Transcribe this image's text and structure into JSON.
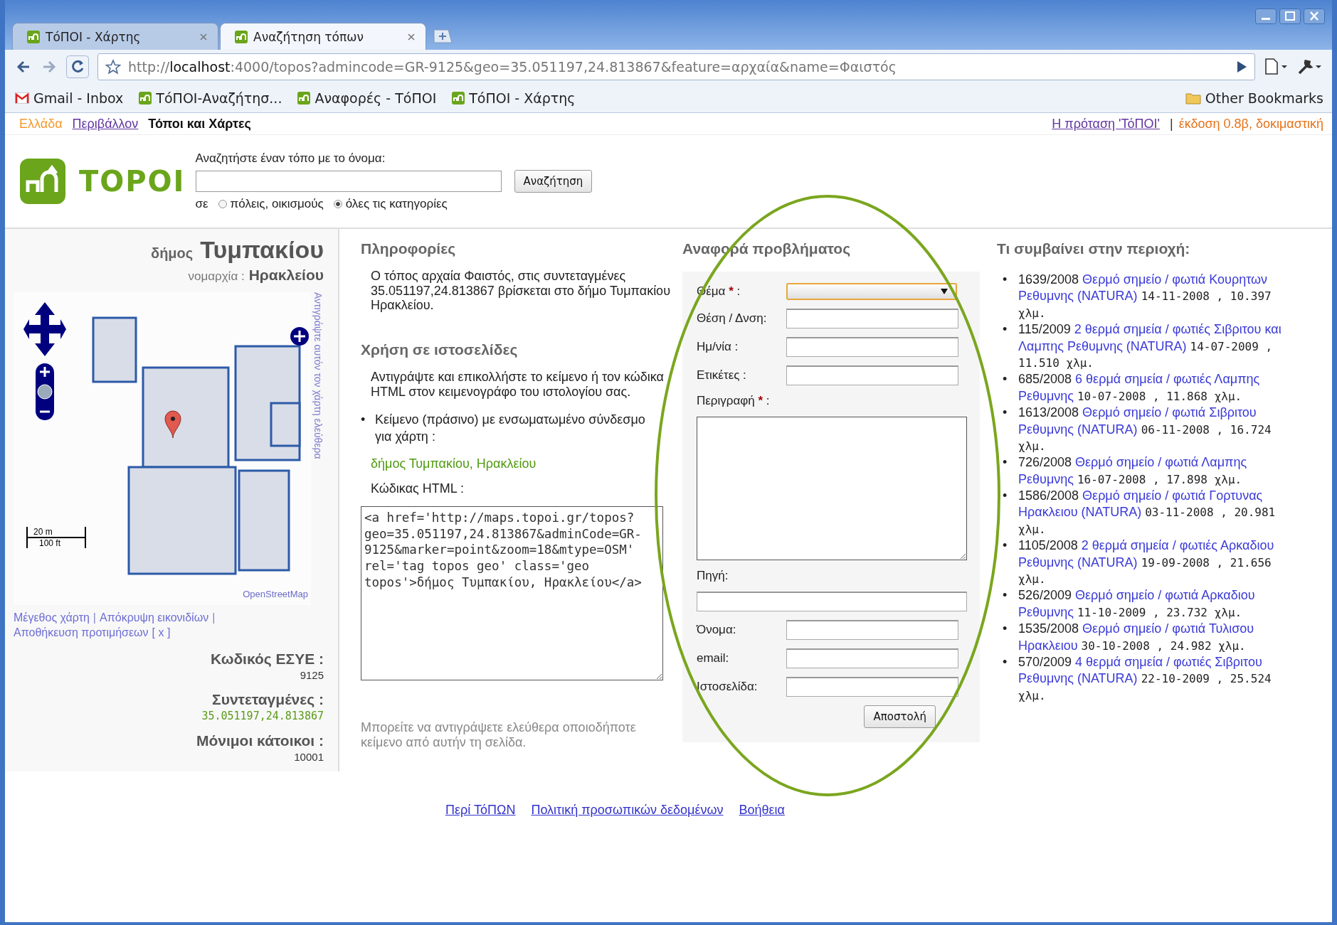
{
  "browser": {
    "tabs": [
      {
        "title": "ΤόΠΟΙ - Χάρτης",
        "selected": false
      },
      {
        "title": "Αναζήτηση τόπων",
        "selected": true
      }
    ],
    "address_bar": {
      "url": "http://**localhost**:4000/topos?admincode=GR-9125&geo=35.051197,24.813867&feature=αρχαία&name=Φαιστός"
    },
    "bookmarks": [
      {
        "kind": "mail",
        "label": "Gmail - Inbox"
      },
      {
        "kind": "site",
        "label": "ΤόΠΟΙ-Αναζήτησ..."
      },
      {
        "kind": "site",
        "label": "Αναφορές - ΤόΠΟΙ"
      },
      {
        "kind": "site",
        "label": "ΤόΠΟΙ - Χάρτης"
      }
    ],
    "other_bookmarks": "Other Bookmarks"
  },
  "top_nav": {
    "left": [
      {
        "kind": "region",
        "label": "Ελλάδα"
      },
      {
        "kind": "link",
        "label": "Περιβάλλον"
      },
      {
        "kind": "current",
        "label": "Τόποι και Χάρτες"
      }
    ],
    "right": [
      {
        "kind": "link",
        "label": "Η πρόταση 'ΤόΠΟΙ'"
      },
      {
        "kind": "separator",
        "label": "|"
      },
      {
        "kind": "version",
        "label": "έκδοση 0.8β, δοκιμαστική"
      }
    ]
  },
  "header": {
    "logo_text": "TOPOI",
    "search_label": "Αναζητήστε έναν τόπο με το όνομα:",
    "search_button": "Αναζήτηση",
    "scope_label": "σε",
    "scope_options": [
      {
        "label": "πόλεις, οικισμούς",
        "selected": false
      },
      {
        "label": "όλες τις κατηγορίες",
        "selected": true
      }
    ]
  },
  "place": {
    "municipality_prefix": "δήμος",
    "municipality": "Τυμπακίου",
    "prefecture_label": "νομαρχία :",
    "prefecture": "Ηρακλείου",
    "map": {
      "copy_hint": "Αντιγράψτε αυτόν τον χάρτη ελεύθερα",
      "scale_metric": "20 m",
      "scale_imperial": "100 ft",
      "attribution": "OpenStreetMap"
    },
    "map_links": [
      {
        "kind": "link",
        "label": "Μέγεθος χάρτη"
      },
      {
        "kind": "separator",
        "label": "|"
      },
      {
        "kind": "link",
        "label": "Απόκρυψη εικονιδίων"
      },
      {
        "kind": "separator",
        "label": "|"
      },
      {
        "kind": "link",
        "label": "Αποθήκευση προτιμήσεων"
      },
      {
        "kind": "link",
        "label": "[ x ]"
      }
    ],
    "facts": [
      {
        "label": "Κωδικός ΕΣΥΕ :",
        "value": "9125",
        "kind": "plain"
      },
      {
        "label": "Συντεταγμένες :",
        "value": "35.051197,24.813867",
        "kind": "coords"
      },
      {
        "label": "Μόνιμοι κάτοικοι :",
        "value": "10001",
        "kind": "plain"
      }
    ]
  },
  "info": {
    "heading": "Πληροφορίες",
    "text": "Ο τόπος αρχαία Φαιστός, στις συντεταγμένες 35.051197,24.813867 βρίσκεται στο δήμο Τυμπακίου Ηρακλείου."
  },
  "usage": {
    "heading": "Χρήση σε ιστοσελίδες",
    "intro": "Αντιγράψτε και επικολλήστε το κείμενο ή τον κώδικα HTML στον κειμενογράφο του ιστολογίου σας.",
    "bullet_mark": "•",
    "bullet": "Κείμενο (πράσινο) με ενσωματωμένο σύνδεσμο για χάρτη :",
    "green_link": "δήμος Τυμπακίου, Ηρακλείου",
    "code_label": "Κώδικας HTML :",
    "code": "<a href='http://maps.topoi.gr/topos?geo=35.051197,24.813867&adminCode=GR-9125&marker=point&zoom=18&mtype=OSM' rel='tag topos geo' class='geo topos'>δήμος Τυμπακίου, Ηρακλείου</a>",
    "note": "Μπορείτε να αντιγράψετε ελεύθερα οποιοδήποτε κείμενο από αυτήν τη σελίδα."
  },
  "report": {
    "heading": "Αναφορά προβλήματος",
    "fields": [
      {
        "kind": "select",
        "label": "Θέμα",
        "required": true,
        "focused": true
      },
      {
        "kind": "input",
        "label": "Θέση / Δνση:",
        "required": false,
        "focused": false
      },
      {
        "kind": "input",
        "label": "Ημ/νία :",
        "required": false,
        "focused": false
      },
      {
        "kind": "input",
        "label": "Ετικέτες :",
        "required": false,
        "focused": false
      },
      {
        "kind": "textarea",
        "label": "Περιγραφή",
        "required": true,
        "focused": false
      },
      {
        "kind": "wide",
        "label": "Πηγή:",
        "required": false,
        "focused": false
      },
      {
        "kind": "input",
        "label": "Όνομα:",
        "required": false,
        "focused": false
      },
      {
        "kind": "input",
        "label": "email:",
        "required": false,
        "focused": false
      },
      {
        "kind": "input",
        "label": "Ιστοσελίδα:",
        "required": false,
        "focused": false
      }
    ],
    "required_mark": "*",
    "label_suffix": ":",
    "submit": "Αποστολή"
  },
  "nearby": {
    "heading": "Τι συμβαίνει στην περιοχή:",
    "bullet_mark": "•",
    "items": [
      {
        "number": "1639/2008",
        "title": "Θερμό σημείο / φωτιά Κουρητων Ρεθυμνης (NATURA)",
        "meta": "14-11-2008 , 10.397 χλμ."
      },
      {
        "number": "115/2009",
        "title": "2 θερμά σημεία / φωτιές Σιβριτου και Λαμπης Ρεθυμνης (NATURA)",
        "meta": "14-07-2009 , 11.510 χλμ."
      },
      {
        "number": "685/2008",
        "title": "6 θερμά σημεία / φωτιές Λαμπης Ρεθυμνης",
        "meta": "10-07-2008 , 11.868 χλμ."
      },
      {
        "number": "1613/2008",
        "title": "Θερμό σημείο / φωτιά Σιβριτου Ρεθυμνης (NATURA)",
        "meta": "06-11-2008 , 16.724 χλμ."
      },
      {
        "number": "726/2008",
        "title": "Θερμό σημείο / φωτιά Λαμπης Ρεθυμνης",
        "meta": "16-07-2008 , 17.898 χλμ."
      },
      {
        "number": "1586/2008",
        "title": "Θερμό σημείο / φωτιά Γορτυνας Ηρακλειου (NATURA)",
        "meta": "03-11-2008 , 20.981 χλμ."
      },
      {
        "number": "1105/2008",
        "title": "2 θερμά σημεία / φωτιές Αρκαδιου Ρεθυμνης (NATURA)",
        "meta": "19-09-2008 , 21.656 χλμ."
      },
      {
        "number": "526/2009",
        "title": "Θερμό σημείο / φωτιά Αρκαδιου Ρεθυμνης",
        "meta": "11-10-2009 , 23.732 χλμ."
      },
      {
        "number": "1535/2008",
        "title": "Θερμό σημείο / φωτιά Τυλισου Ηρακλειου",
        "meta": "30-10-2008 , 24.982 χλμ."
      },
      {
        "number": "570/2009",
        "title": "4 θερμά σημεία / φωτιές Σιβριτου Ρεθυμνης (NATURA)",
        "meta": "22-10-2009 , 25.524 χλμ."
      }
    ]
  },
  "footer": [
    "Περί ΤόΠΩΝ",
    "Πολιτική προσωπικών δεδομένων",
    "Βοήθεια"
  ]
}
